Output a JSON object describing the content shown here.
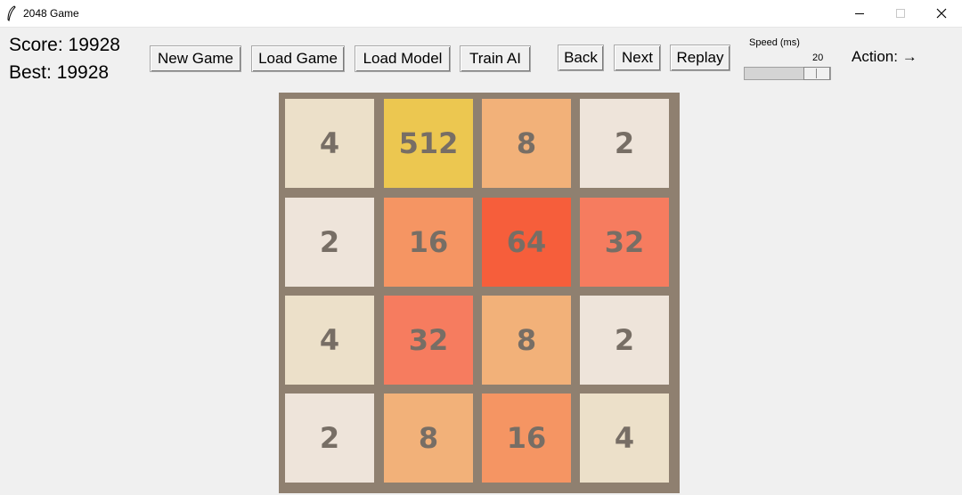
{
  "window": {
    "title": "2048 Game"
  },
  "scores": {
    "score_text": "Score: 19928",
    "best_text": "Best: 19928"
  },
  "buttons": {
    "new_game": "New Game",
    "load_game": "Load Game",
    "load_model": "Load Model",
    "train_ai": "Train AI",
    "back": "Back",
    "next": "Next",
    "replay": "Replay"
  },
  "speed": {
    "label": "Speed (ms)",
    "value": "20"
  },
  "action": {
    "text": "Action: →"
  },
  "board": {
    "rows": [
      [
        {
          "value": "4",
          "color": "#ece0c9"
        },
        {
          "value": "512",
          "color": "#ecc750"
        },
        {
          "value": "8",
          "color": "#f2b179"
        },
        {
          "value": "2",
          "color": "#eee4da"
        }
      ],
      [
        {
          "value": "2",
          "color": "#eee4da"
        },
        {
          "value": "16",
          "color": "#f59563"
        },
        {
          "value": "64",
          "color": "#f65e3b"
        },
        {
          "value": "32",
          "color": "#f67c5f"
        }
      ],
      [
        {
          "value": "4",
          "color": "#ece0c9"
        },
        {
          "value": "32",
          "color": "#f67c5f"
        },
        {
          "value": "8",
          "color": "#f2b179"
        },
        {
          "value": "2",
          "color": "#eee4da"
        }
      ],
      [
        {
          "value": "2",
          "color": "#eee4da"
        },
        {
          "value": "8",
          "color": "#f2b179"
        },
        {
          "value": "16",
          "color": "#f59563"
        },
        {
          "value": "4",
          "color": "#ece0c9"
        }
      ]
    ]
  },
  "colors": {
    "board_background": "#8f8070",
    "tile_text": "#776e65"
  }
}
